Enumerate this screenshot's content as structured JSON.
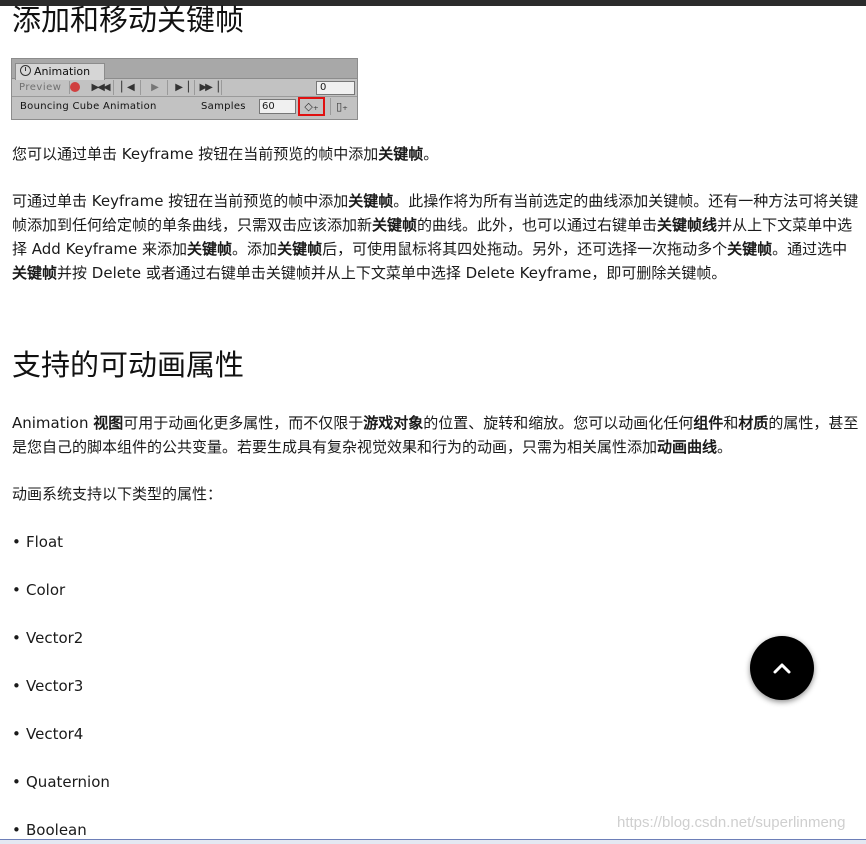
{
  "sections": [
    {
      "title": "添加和移动关键帧"
    },
    {
      "title": "支持的可动画属性"
    }
  ],
  "animation_window": {
    "tab_label": "Animation",
    "preview_label": "Preview",
    "frame_value": "0",
    "clip_name": "Bouncing Cube Animation",
    "samples_label": "Samples",
    "samples_value": "60",
    "buttons": [
      "first-frame",
      "prev-frame",
      "play",
      "next-frame",
      "last-frame",
      "add-keyframe",
      "add-event"
    ]
  },
  "paragraphs": {
    "p1": [
      {
        "t": "您可以通过单击 Keyframe 按钮在当前预览的帧中添加"
      },
      {
        "t": "关键帧",
        "b": true
      },
      {
        "t": "。"
      }
    ],
    "p2": [
      {
        "t": "可通过单击 Keyframe 按钮在当前预览的帧中添加"
      },
      {
        "t": "关键帧",
        "b": true
      },
      {
        "t": "。此操作将为所有当前选定的曲线添加关键帧。还有一种方法可将关键帧添加到任何给定帧的单条曲线，只需双击应该添加新"
      },
      {
        "t": "关键帧",
        "b": true
      },
      {
        "t": "的曲线。此外，也可以通过右键单击"
      },
      {
        "t": "关键帧线",
        "b": true
      },
      {
        "t": "并从上下文菜单中选择 Add Keyframe 来添加"
      },
      {
        "t": "关键帧",
        "b": true
      },
      {
        "t": "。添加"
      },
      {
        "t": "关键帧",
        "b": true
      },
      {
        "t": "后，可使用鼠标将其四处拖动。另外，还可选择一次拖动多个"
      },
      {
        "t": "关键帧",
        "b": true
      },
      {
        "t": "。通过选中"
      },
      {
        "t": "关键帧",
        "b": true
      },
      {
        "t": "并按 Delete 或者通过右键单击关键帧并从上下文菜单中选择 Delete Keyframe，即可删除关键帧。"
      }
    ],
    "p3": [
      {
        "t": "Animation "
      },
      {
        "t": "视图",
        "b": true
      },
      {
        "t": "可用于动画化更多属性，而不仅限于"
      },
      {
        "t": "游戏对象",
        "b": true
      },
      {
        "t": "的位置、旋转和缩放。您可以动画化任何"
      },
      {
        "t": "组件",
        "b": true
      },
      {
        "t": "和"
      },
      {
        "t": "材质",
        "b": true
      },
      {
        "t": "的属性，甚至是您自己的脚本组件的公共变量。若要生成具有复杂视觉效果和行为的动画，只需为相关属性添加"
      },
      {
        "t": "动画曲线",
        "b": true
      },
      {
        "t": "。"
      }
    ],
    "p4": [
      {
        "t": "动画系统支持以下类型的属性："
      }
    ]
  },
  "property_types": [
    "Float",
    "Color",
    "Vector2",
    "Vector3",
    "Vector4",
    "Quaternion",
    "Boolean"
  ],
  "watermark": "https://blog.csdn.net/superlinmeng",
  "back_to_top_icon": "chevron-up-icon"
}
